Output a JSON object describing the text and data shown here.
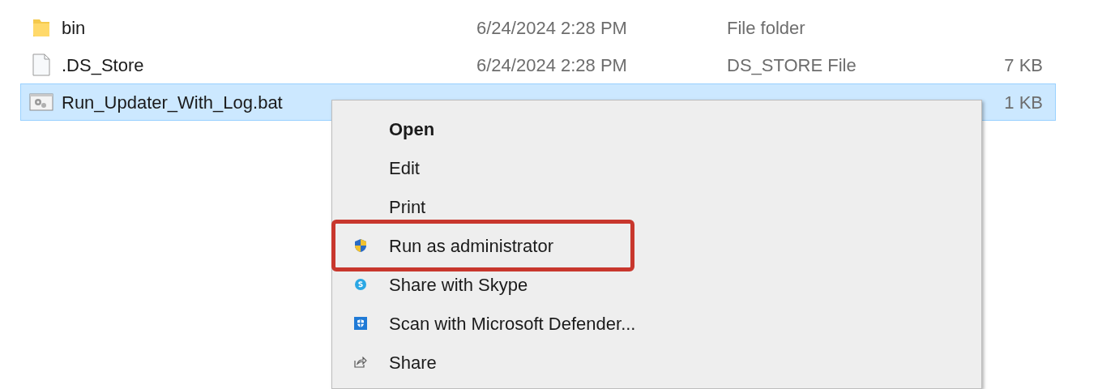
{
  "files": [
    {
      "kind": "folder",
      "name": "bin",
      "date": "6/24/2024 2:28 PM",
      "type": "File folder",
      "selected": false
    },
    {
      "kind": "file",
      "name": ".DS_Store",
      "date": "6/24/2024 2:28 PM",
      "type": "DS_STORE File",
      "size": "7 KB",
      "selected": false
    },
    {
      "kind": "batch",
      "name": "Run_Updater_With_Log.bat",
      "size": "1 KB",
      "selected": true
    }
  ],
  "context_menu": {
    "items": [
      {
        "kind": "plain",
        "label": "Open",
        "default": true,
        "highlighted": false
      },
      {
        "kind": "plain",
        "label": "Edit",
        "default": false,
        "highlighted": false
      },
      {
        "kind": "plain",
        "label": "Print",
        "default": false,
        "highlighted": false
      },
      {
        "kind": "shield",
        "label": "Run as administrator",
        "default": false,
        "highlighted": true
      },
      {
        "kind": "skype",
        "label": "Share with Skype",
        "default": false,
        "highlighted": false
      },
      {
        "kind": "defender",
        "label": "Scan with Microsoft Defender...",
        "default": false,
        "highlighted": false
      },
      {
        "kind": "share",
        "label": "Share",
        "default": false,
        "highlighted": false
      }
    ]
  }
}
